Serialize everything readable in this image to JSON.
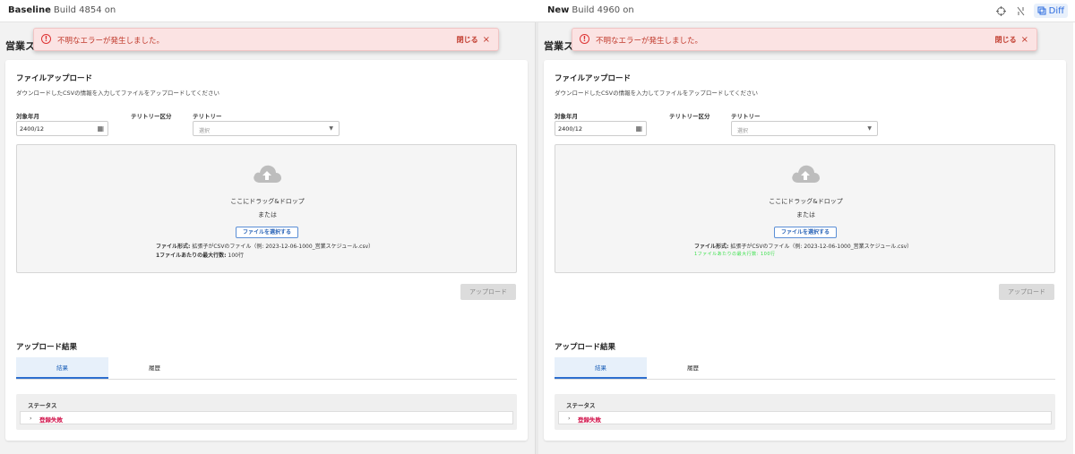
{
  "topbar": {
    "baseline_label": "Baseline",
    "baseline_build": "Build 4854 on",
    "new_label": "New",
    "new_build": "Build 4960 on",
    "diff_label": "Diff"
  },
  "panes": {
    "page_title": "営業ス",
    "toast": {
      "message": "不明なエラーが発生しました。",
      "close_label": "閉じる",
      "close_x": "×",
      "icon": "!"
    },
    "upload": {
      "title": "ファイルアップロード",
      "description": "ダウンロードしたCSVの情報を入力してファイルをアップロードしてください",
      "label_month": "対象年月",
      "label_territory_div": "テリトリー区分",
      "label_territory": "テリトリー",
      "date_value": "2400/12",
      "select_placeholder": "選択",
      "dz_drag": "ここにドラッグ&ドロップ",
      "dz_or": "または",
      "select_file": "ファイルを選択する",
      "fmt_label": "ファイル形式:",
      "fmt_value": "拡張子がCSVのファイル（例: 2023-12-06-1000_営業スケジュール.csv）",
      "max_rows_label": "1ファイルあたりの最大行数:",
      "max_rows_value": "100行",
      "glitch_text": "1ファイルあたりの最大行数: 100行",
      "upload_button": "アップロード"
    },
    "results": {
      "title": "アップロード結果",
      "tab_results": "結果",
      "tab_history": "履歴",
      "status_header": "ステータス",
      "status_value": "登録失敗"
    }
  }
}
